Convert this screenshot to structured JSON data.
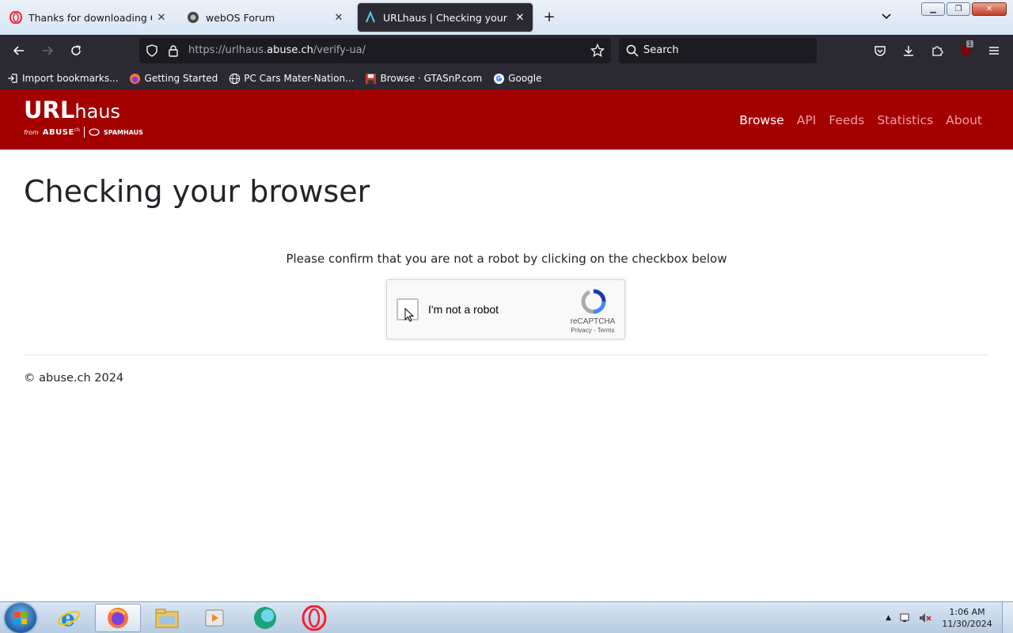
{
  "browser": {
    "tabs": [
      {
        "title": "Thanks for downloading Opera",
        "icon": "opera-icon",
        "active": false
      },
      {
        "title": "webOS Forum",
        "icon": "forum-favicon",
        "active": false
      },
      {
        "title": "URLhaus | Checking your brows",
        "icon": "urlhaus-favicon",
        "active": true
      }
    ],
    "url": {
      "prefix": "https://urlhaus.",
      "domain": "abuse.ch",
      "path": "/verify-ua/"
    },
    "search_placeholder": "Search",
    "extension_badge": "1",
    "bookmarks": [
      {
        "label": "Import bookmarks...",
        "icon": "import-icon"
      },
      {
        "label": "Getting Started",
        "icon": "firefox-icon"
      },
      {
        "label": "PC Cars Mater-Nation...",
        "icon": "globe-icon"
      },
      {
        "label": "Browse · GTASnP.com",
        "icon": "floppy-icon"
      },
      {
        "label": "Google",
        "icon": "google-icon"
      }
    ]
  },
  "site": {
    "logo": {
      "main": "URL",
      "main_suffix": "haus",
      "from": "from",
      "abuse": "ABUSE",
      "abuse_sup": "ch",
      "partner": "SPAMHAUS"
    },
    "nav": [
      {
        "label": "Browse",
        "current": true
      },
      {
        "label": "API",
        "current": false
      },
      {
        "label": "Feeds",
        "current": false
      },
      {
        "label": "Statistics",
        "current": false
      },
      {
        "label": "About",
        "current": false
      }
    ],
    "accent_color": "#a30000"
  },
  "page": {
    "heading": "Checking your browser",
    "prompt": "Please confirm that you are not a robot by clicking on the checkbox below",
    "captcha": {
      "label": "I'm not a robot",
      "brand": "reCAPTCHA",
      "privacy": "Privacy",
      "separator": "-",
      "terms": "Terms",
      "checked": false
    },
    "footer": "© abuse.ch 2024"
  },
  "taskbar": {
    "apps": [
      "internet-explorer-icon",
      "firefox-icon",
      "file-explorer-icon",
      "media-player-icon",
      "browser-globe-icon",
      "opera-icon"
    ],
    "time": "1:06 AM",
    "date": "11/30/2024"
  }
}
